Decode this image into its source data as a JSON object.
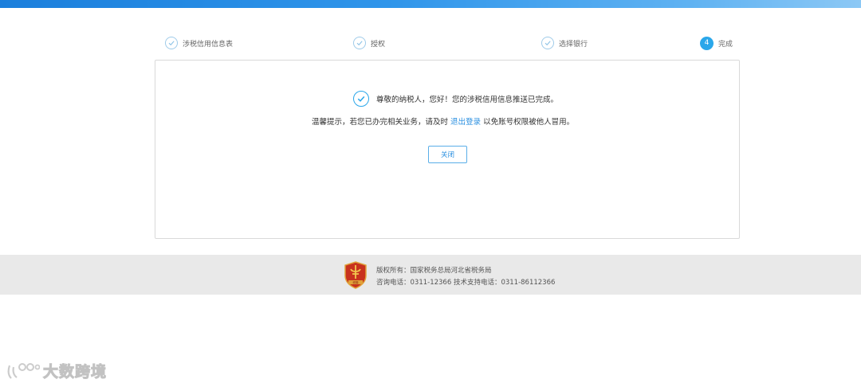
{
  "steps": [
    {
      "label": "涉税信用信息表",
      "state": "done"
    },
    {
      "label": "授权",
      "state": "done"
    },
    {
      "label": "选择银行",
      "state": "done"
    },
    {
      "number": "4",
      "label": "完成",
      "state": "current"
    }
  ],
  "result": {
    "success_message": "尊敬的纳税人，您好！您的涉税信用信息推送已完成。",
    "tip_prefix": "温馨提示，若您已办完相关业务，请及时",
    "logout_link": "退出登录",
    "tip_suffix": "以免账号权限被他人冒用。",
    "close_label": "关闭"
  },
  "footer": {
    "copyright": "版权所有：国家税务总局河北省税务局",
    "contact": "咨询电话：0311-12366  技术支持电话：0311-86112366",
    "emblem_text": "税徽"
  },
  "watermark": {
    "text": "大数跨境"
  },
  "colors": {
    "accent": "#2aa7ea",
    "link": "#2a8fe0",
    "footer_bg": "#e9e9e9",
    "topbar": "#2f95ea"
  },
  "icons": {
    "step_done": "check-circle-icon",
    "success": "check-circle-icon",
    "emblem": "tax-emblem-icon",
    "watermark": "brand-logo-icon"
  }
}
